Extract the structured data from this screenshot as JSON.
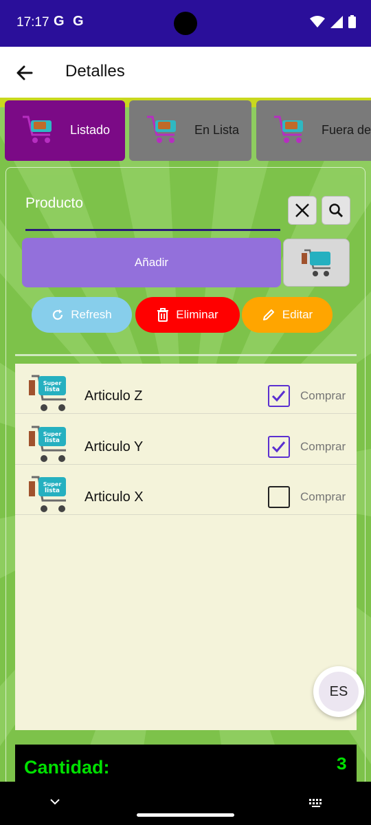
{
  "status_bar": {
    "time": "17:17",
    "g1": "G",
    "g2": "G"
  },
  "app_bar": {
    "title": "Detalles"
  },
  "tabs": [
    {
      "label": "Listado",
      "active": true
    },
    {
      "label": "En Lista",
      "active": false
    },
    {
      "label": "Fuera de",
      "active": false
    }
  ],
  "search": {
    "label": "Producto"
  },
  "actions": {
    "add_label": "Añadir",
    "refresh_label": "Refresh",
    "delete_label": "Eliminar",
    "edit_label": "Editar"
  },
  "items": [
    {
      "name": "Articulo Z",
      "checked": true,
      "action": "Comprar"
    },
    {
      "name": "Articulo Y",
      "checked": true,
      "action": "Comprar"
    },
    {
      "name": "Articulo X",
      "checked": false,
      "action": "Comprar"
    }
  ],
  "language_button": "ES",
  "total": {
    "label": "Cantidad:",
    "value": "3"
  },
  "colors": {
    "status_bar": "#2a0f9a",
    "background": "#7dc24a",
    "tab_active": "#7b0a86",
    "tab_inactive": "#7a7a7a",
    "add_button": "#9370db",
    "refresh": "#87ceeb",
    "delete": "#ff0000",
    "edit": "#ffa500",
    "list_bg": "#f4f3da",
    "check_accent": "#5a2fd0",
    "total_text": "#00e000"
  }
}
